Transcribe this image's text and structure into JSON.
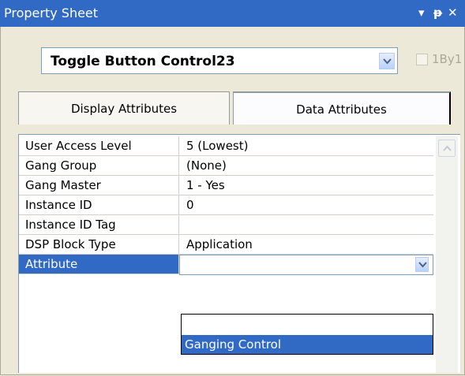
{
  "window": {
    "title": "Property Sheet",
    "controls": {
      "menu_glyph": "▾",
      "pin_glyph": "ᵽ",
      "close_glyph": "✕"
    }
  },
  "object_selector": {
    "selected": "Toggle Button Control23",
    "checkbox_label": "1By1",
    "checkbox_checked": false
  },
  "tabs": [
    {
      "label": "Display Attributes",
      "active": false
    },
    {
      "label": "Data Attributes",
      "active": true
    }
  ],
  "properties": [
    {
      "name": "User Access Level",
      "value": "5 (Lowest)"
    },
    {
      "name": "Gang Group",
      "value": "(None)"
    },
    {
      "name": "Gang Master",
      "value": "1 - Yes"
    },
    {
      "name": "Instance ID",
      "value": "0"
    },
    {
      "name": "Instance ID Tag",
      "value": ""
    },
    {
      "name": "DSP Block Type",
      "value": "Application"
    },
    {
      "name": "Attribute",
      "value": ""
    }
  ],
  "attribute_dropdown": {
    "options": [
      "",
      "Ganging Control"
    ],
    "highlighted": "Ganging Control"
  },
  "colors": {
    "title_bar": "#316ac5",
    "selection": "#316ac5",
    "panel": "#ece9d8"
  },
  "icons": [
    "chevron-down-icon",
    "pin-icon",
    "close-icon",
    "scroll-up-icon"
  ]
}
